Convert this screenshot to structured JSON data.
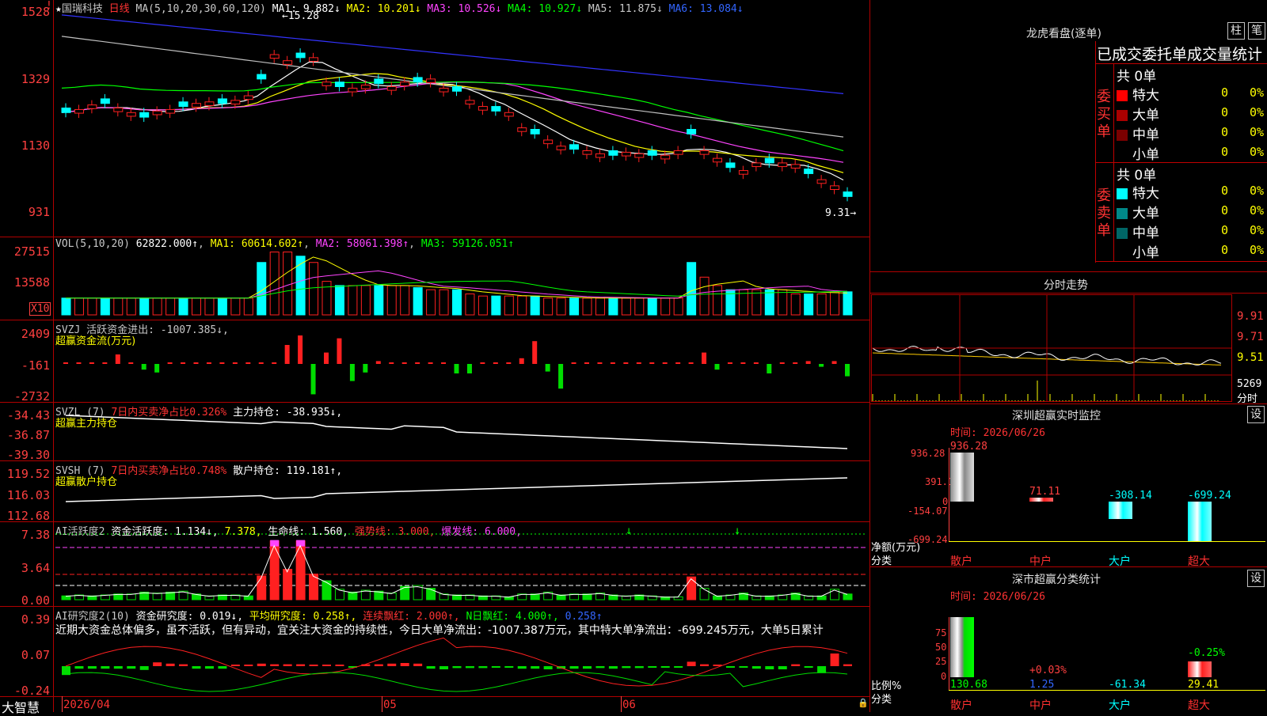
{
  "header": {
    "stock_name": "国瑞科技",
    "period": "日线",
    "ma_title": "MA(5,10,20,30,60,120)",
    "ma1": "MA1: 9.882↓",
    "ma2": "MA2: 10.201↓",
    "ma3": "MA3: 10.526↓",
    "ma4": "MA4: 10.927↓",
    "ma5": "MA5: 11.875↓",
    "ma6": "MA6: 13.084↓",
    "high_marker": "15.28",
    "low_marker": "9.31"
  },
  "price_axis": [
    "1528",
    "1329",
    "1130",
    "931"
  ],
  "vol_panel": {
    "title": "VOL(5,10,20)",
    "value": "62822.000↑",
    "ma1": "MA1: 60614.602↑",
    "ma2": "MA2: 58061.398↑",
    "ma3": "MA3: 59126.051↑",
    "axis": [
      "27515",
      "13588"
    ],
    "unit": "X10"
  },
  "svzj_panel": {
    "title": "SVZJ",
    "label": "活跃资金进出: -1007.385↓,",
    "subtitle": "超赢资金流(万元)",
    "axis": [
      "2409",
      "-161",
      "-2732"
    ]
  },
  "svzl_panel": {
    "title": "SVZL (7)",
    "ratio": "7日内买卖净占比0.326%",
    "label": "主力持仓: -38.935↓,",
    "subtitle": "超赢主力持仓",
    "axis": [
      "-34.43",
      "-36.87",
      "-39.30"
    ]
  },
  "svsh_panel": {
    "title": "SVSH (7)",
    "ratio": "7日内买卖净占比0.748%",
    "label": "散户持仓: 119.181↑,",
    "subtitle": "超赢散户持仓",
    "axis": [
      "119.52",
      "116.03",
      "112.68"
    ]
  },
  "ai_active_panel": {
    "title": "AI活跃度2",
    "label1": "资金活跃度: 1.134↓,",
    "label2": "7.378,",
    "label3": "生命线: 1.560,",
    "label4": "强势线: 3.000,",
    "label5": "爆发线: 6.000,",
    "axis": [
      "7.38",
      "3.64",
      "0.00"
    ]
  },
  "ai_research_panel": {
    "title": "AI研究度2(10)",
    "label1": "资金研究度: 0.019↓,",
    "label2": "平均研究度: 0.258↑,",
    "label3": "连续飘红: 2.000↑,",
    "label4": "N日飘红: 4.000↑,",
    "label5": "0.258↑",
    "comment": "近期大资金总体偏多，虽不活跃，但有异动，宜关注大资金的持续性，今日大单净流出：-1007.387万元，其中特大单净流出：-699.245万元，大单5日累计",
    "axis": [
      "0.39",
      "0.07",
      "-0.24"
    ]
  },
  "time_axis": {
    "app_name": "大智慧",
    "dates": [
      "2026/04",
      "05",
      "06"
    ]
  },
  "longhu": {
    "title": "龙虎看盘(逐单)",
    "btn_column": "柱",
    "btn_pen": "笔",
    "subtitle": "已成交委托单成交量统计",
    "buy_label": "委买单",
    "buy_total": "共 0单",
    "sell_label": "委卖单",
    "sell_total": "共 0单",
    "buy_rows": [
      {
        "name": "特大",
        "count": "0",
        "pct": "0%",
        "color": "#ff0000"
      },
      {
        "name": "大单",
        "count": "0",
        "pct": "0%",
        "color": "#aa0000"
      },
      {
        "name": "中单",
        "count": "0",
        "pct": "0%",
        "color": "#7a0000"
      },
      {
        "name": "小单",
        "count": "0",
        "pct": "0%",
        "color": "#000000"
      }
    ],
    "sell_rows": [
      {
        "name": "特大",
        "count": "0",
        "pct": "0%",
        "color": "#00ffff"
      },
      {
        "name": "大单",
        "count": "0",
        "pct": "0%",
        "color": "#008888"
      },
      {
        "name": "中单",
        "count": "0",
        "pct": "0%",
        "color": "#006666"
      },
      {
        "name": "小单",
        "count": "0",
        "pct": "0%",
        "color": "#000000"
      }
    ]
  },
  "intraday": {
    "title": "分时走势",
    "axis": [
      "9.91",
      "9.71",
      "9.51"
    ],
    "vol_label": "5269",
    "vol_unit": "分时"
  },
  "sz_monitor": {
    "title": "深圳超赢实时监控",
    "set_btn": "设",
    "time": "时间: 2026/06/26",
    "axis": [
      "936.28",
      "391.1",
      "0",
      "-154.07",
      "-699.24"
    ],
    "y_title": "净额(万元)",
    "x_title": "分类",
    "categories": [
      "散户",
      "中户",
      "大户",
      "超大"
    ],
    "values": [
      "936.28",
      "71.11",
      "-308.14",
      "-699.24"
    ]
  },
  "sz_category": {
    "title": "深市超赢分类统计",
    "set_btn": "设",
    "time": "时间: 2026/06/26",
    "axis": [
      "75",
      "50",
      "25",
      "0"
    ],
    "y_title": "比例%",
    "x_title": "分类",
    "categories": [
      "散户",
      "中户",
      "大户",
      "超大"
    ],
    "values": [
      "130.68",
      "1.25",
      "-61.34",
      "29.41"
    ],
    "pct_labels": [
      "+0.03%",
      "-0.25%"
    ]
  },
  "colors": {
    "up": "#ff2020",
    "down": "#00ffff",
    "border": "#b00000"
  }
}
